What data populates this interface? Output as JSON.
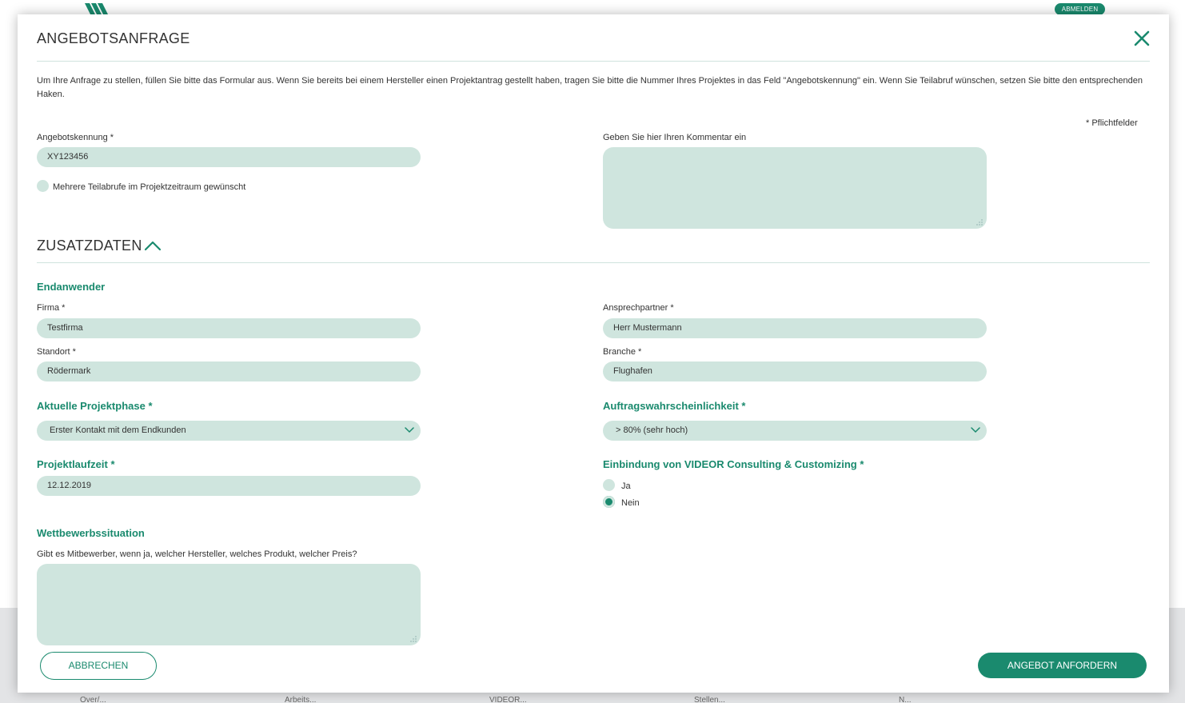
{
  "header": {
    "logout_label": "ABMELDEN"
  },
  "footer": {
    "items": [
      "Over/...",
      "Arbeits...",
      "VIDEOR...",
      "Stellen...",
      "N..."
    ]
  },
  "modal": {
    "title": "ANGEBOTSANFRAGE",
    "intro": "Um Ihre Anfrage zu stellen, füllen Sie bitte das Formular aus. Wenn Sie bereits bei einem Hersteller einen Projektantrag gestellt haben, tragen Sie bitte die Nummer Ihres Projektes in das Feld \"Angebotskennung\" ein. Wenn Sie Teilabruf wünschen, setzen Sie bitte den entsprechenden Haken.",
    "required_note": "* Pflichtfelder",
    "offer_id": {
      "label": "Angebotskennung *",
      "value": "XY123456"
    },
    "partial_calls": {
      "label": "Mehrere Teilabrufe im Projektzeitraum gewünscht",
      "checked": false
    },
    "comment": {
      "label": "Geben Sie hier Ihren Kommentar ein",
      "value": ""
    },
    "section_title": "ZUSATZDATEN",
    "end_user": {
      "title": "Endanwender",
      "company": {
        "label": "Firma *",
        "value": "Testfirma"
      },
      "contact": {
        "label": "Ansprechpartner *",
        "value": "Herr Mustermann"
      },
      "location": {
        "label": "Standort *",
        "value": "Rödermark"
      },
      "industry": {
        "label": "Branche *",
        "value": "Flughafen"
      }
    },
    "project_phase": {
      "title": "Aktuelle Projektphase *",
      "value": "Erster Kontakt mit dem Endkunden"
    },
    "probability": {
      "title": "Auftragswahrscheinlichkeit *",
      "value": "> 80% (sehr hoch)"
    },
    "duration": {
      "title": "Projektlaufzeit *",
      "value": "12.12.2019"
    },
    "consulting": {
      "title": "Einbindung von VIDEOR Consulting & Customizing *",
      "options": [
        {
          "label": "Ja",
          "selected": false
        },
        {
          "label": "Nein",
          "selected": true
        }
      ]
    },
    "competition": {
      "title": "Wettbewerbssituation",
      "label": "Gibt es Mitbewerber, wenn ja, welcher Hersteller, welches Produkt, welcher Preis?",
      "value": ""
    },
    "cancel_label": "ABBRECHEN",
    "submit_label": "ANGEBOT ANFORDERN"
  },
  "colors": {
    "accent": "#1a8a6e",
    "field_bg": "#cfe5de",
    "divider": "#cfe3dd"
  }
}
